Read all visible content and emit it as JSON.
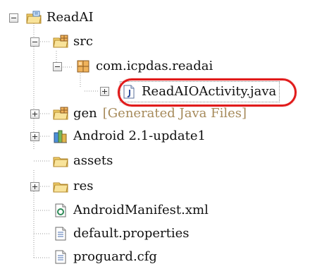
{
  "tree": {
    "items": [
      {
        "label": "ReadAI",
        "icon": "project-folder-icon"
      },
      {
        "label": "src",
        "icon": "source-folder-icon"
      },
      {
        "label": "com.icpdas.readai",
        "icon": "package-icon"
      },
      {
        "label": "ReadAIOActivity.java",
        "icon": "java-file-icon",
        "selected": true
      },
      {
        "label": "gen",
        "decoration": "[Generated Java Files]",
        "icon": "generated-folder-icon"
      },
      {
        "label": "Android 2.1-update1",
        "icon": "android-library-icon"
      },
      {
        "label": "assets",
        "icon": "folder-icon"
      },
      {
        "label": "res",
        "icon": "folder-icon"
      },
      {
        "label": "AndroidManifest.xml",
        "icon": "manifest-file-icon"
      },
      {
        "label": "default.properties",
        "icon": "text-file-icon"
      },
      {
        "label": "proguard.cfg",
        "icon": "text-file-icon"
      }
    ]
  },
  "colors": {
    "highlight": "#e11b1b",
    "decoration": "#a68a5a",
    "tree_lines": "#9a9a9a"
  }
}
